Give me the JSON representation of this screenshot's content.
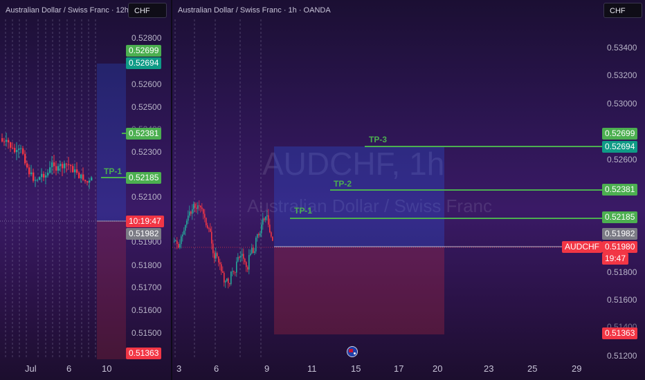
{
  "left": {
    "title": "Australian Dollar / Swiss Franc · 12h",
    "currency_button": "CHF",
    "axis_labels": [
      "0.52800",
      "0.52600",
      "0.52500",
      "0.52400",
      "0.52300",
      "0.52100",
      "0.51900",
      "0.51800",
      "0.51700",
      "0.51600",
      "0.51500"
    ],
    "tags": {
      "p52699": "0.52699",
      "p52694": "0.52694",
      "p52381": "0.52381",
      "p52185": "0.52185",
      "countdown": "10:19:47",
      "p51982": "0.51982",
      "p51363": "0.51363"
    },
    "tp1_label": "TP-1",
    "time_labels": [
      "Jul",
      "6",
      "10"
    ]
  },
  "right": {
    "title": "Australian Dollar / Swiss Franc · 1h · OANDA",
    "currency_button": "CHF",
    "watermark_symbol": "AUDCHF, 1h",
    "watermark_name": "Australian Dollar / Swiss Franc",
    "axis_labels": [
      "0.53400",
      "0.53200",
      "0.53000",
      "0.52600",
      "0.51800",
      "0.51600",
      "0.51400",
      "0.51200"
    ],
    "tags": {
      "p52699": "0.52699",
      "p52694": "0.52694",
      "p52381": "0.52381",
      "p52185": "0.52185",
      "p51982": "0.51982",
      "symbol": "AUDCHF",
      "p51980": "0.51980",
      "countdown": "19:47",
      "p51363": "0.51363"
    },
    "tp_labels": [
      "TP-3",
      "TP-2",
      "TP-1"
    ],
    "time_labels": [
      "3",
      "6",
      "9",
      "11",
      "15",
      "17",
      "20",
      "23",
      "25",
      "29"
    ]
  },
  "colors": {
    "tp_line": "#4caf50",
    "bull": "#26a69a",
    "bear": "#f23645",
    "profit_zone": "#2962ff",
    "stop_zone": "#f23645"
  }
}
